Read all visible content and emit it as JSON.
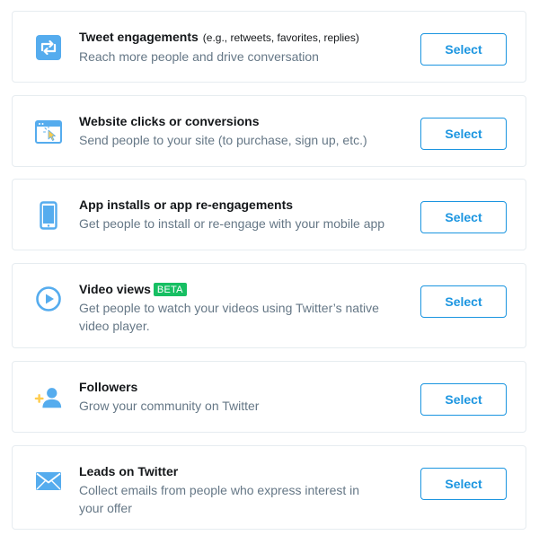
{
  "objectives": [
    {
      "title": "Tweet engagements",
      "hint": "(e.g., retweets, favorites, replies)",
      "description": "Reach more people and drive conversation",
      "button_label": "Select",
      "icon": "retweet-icon"
    },
    {
      "title": "Website clicks or conversions",
      "description": "Send people to your site (to purchase, sign up, etc.)",
      "button_label": "Select",
      "icon": "website-click-icon"
    },
    {
      "title": "App installs or app re-engagements",
      "description": "Get people to install or re-engage with your mobile app",
      "button_label": "Select",
      "icon": "mobile-phone-icon"
    },
    {
      "title": "Video views",
      "badge": "BETA",
      "description": "Get people to watch your videos using Twitter’s native video player.",
      "button_label": "Select",
      "icon": "play-icon"
    },
    {
      "title": "Followers",
      "description": "Grow your community on Twitter",
      "button_label": "Select",
      "icon": "add-follower-icon"
    },
    {
      "title": "Leads on Twitter",
      "description": "Collect emails from people who express interest in your offer",
      "button_label": "Select",
      "icon": "envelope-icon"
    }
  ],
  "colors": {
    "accent": "#1b95e0",
    "icon_blue": "#55acee",
    "badge_green": "#17bf63",
    "follower_plus": "#ffcc4d",
    "title_text": "#14171a",
    "description_text": "#657786",
    "card_border": "#e6ecf0"
  }
}
